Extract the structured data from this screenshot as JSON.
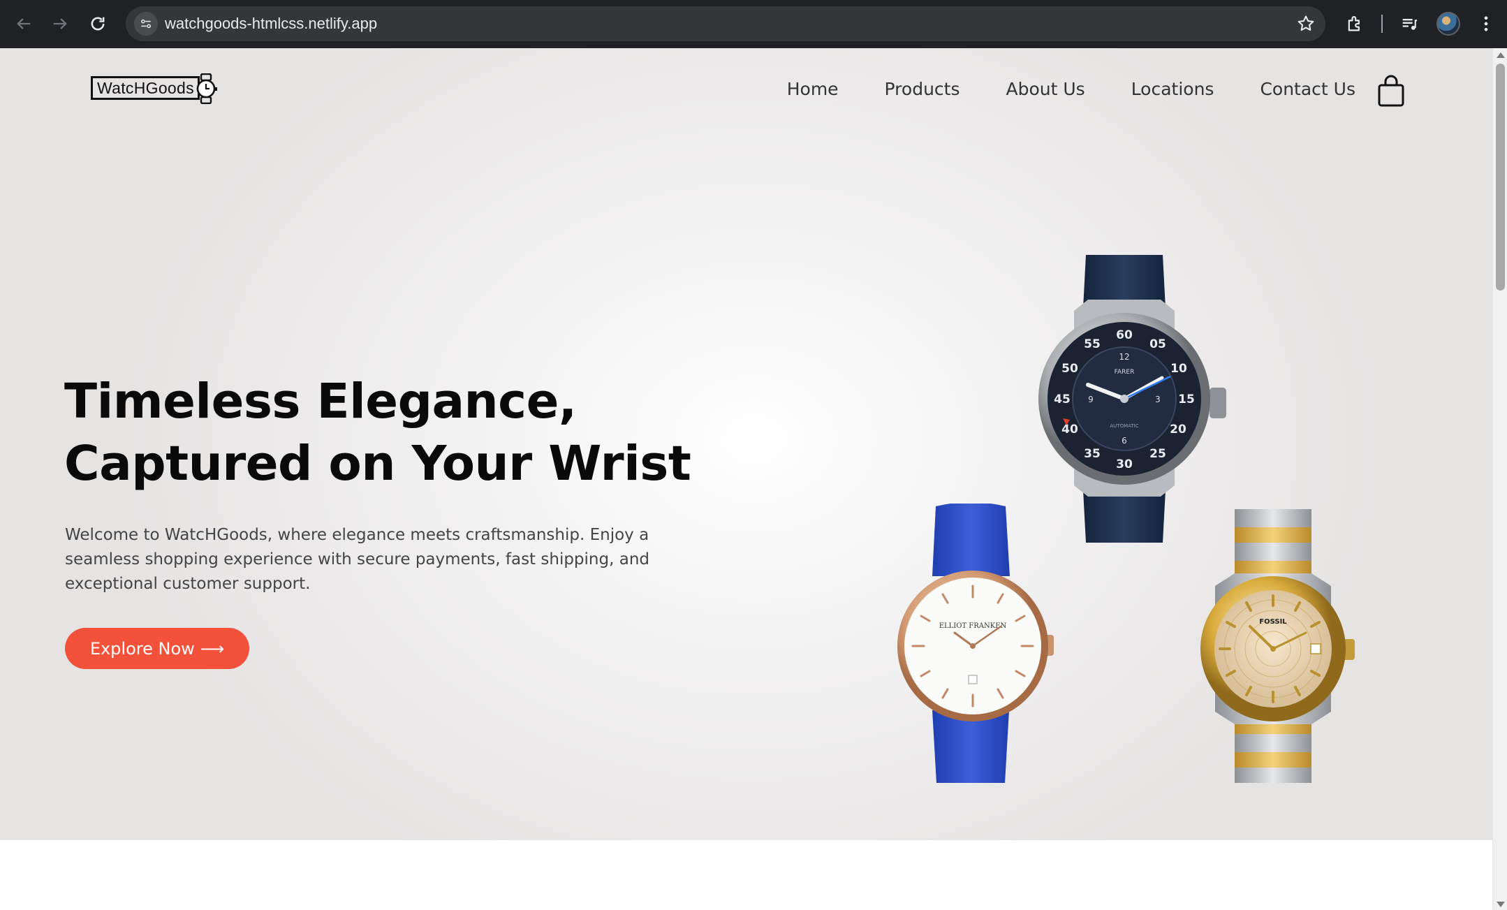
{
  "browser": {
    "url": "watchgoods-htmlcss.netlify.app",
    "icons": [
      "back-icon",
      "forward-icon",
      "reload-icon",
      "site-settings-icon",
      "bookmark-star-icon",
      "extensions-icon",
      "media-controls-icon",
      "profile-avatar",
      "kebab-menu-icon"
    ]
  },
  "site": {
    "logo_text": "WatcHGoods",
    "nav": [
      "Home",
      "Products",
      "About Us",
      "Locations",
      "Contact Us"
    ],
    "cart_icon": "shopping-bag-icon"
  },
  "hero": {
    "title_line1": "Timeless Elegance,",
    "title_line2": "Captured on Your Wrist",
    "description": "Welcome to WatcHGoods, where elegance meets craftsmanship. Enjoy a seamless shopping experience with secure payments, fast shipping, and exceptional customer support.",
    "cta_label": "Explore Now",
    "cta_arrow": "⟶",
    "accent_color": "#f4513a"
  },
  "watches": [
    {
      "brand": "FARER",
      "dial_text": "AUTOMATIC",
      "strap": "navy fabric",
      "dial": "dark navy"
    },
    {
      "brand": "ELLIOT FRANKEN",
      "strap": "blue leather",
      "case": "rose gold",
      "dial": "white"
    },
    {
      "brand": "FOSSIL",
      "strap": "two-tone steel bracelet",
      "case": "gold",
      "dial": "champagne"
    }
  ]
}
